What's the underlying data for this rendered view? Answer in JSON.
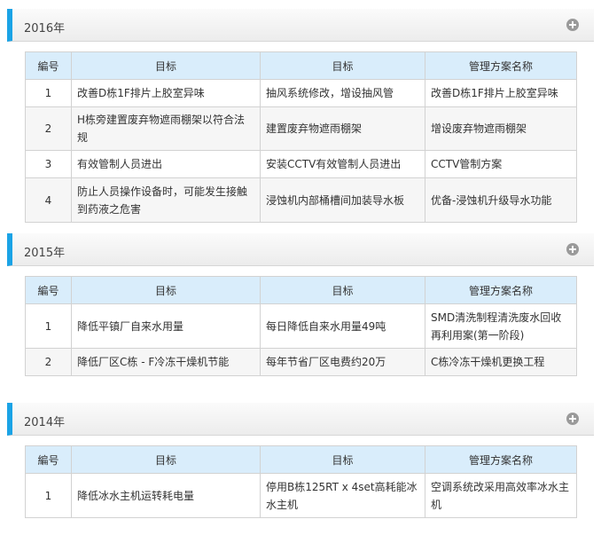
{
  "sections": [
    {
      "year": "2016年",
      "headers": [
        "編号",
        "目标",
        "目标",
        "管理方案名称"
      ],
      "rows": [
        [
          "1",
          "改善D栋1F排片上胶室异味",
          "抽风系统修改，增设抽风管",
          "改善D栋1F排片上胶室异味"
        ],
        [
          "2",
          "H栋旁建置废弃物遮雨棚架以符合法规",
          "建置废弃物遮雨棚架",
          "增设废弃物遮雨棚架"
        ],
        [
          "3",
          "有效管制人员进出",
          "安装CCTV有效管制人员进出",
          "CCTV管制方案"
        ],
        [
          "4",
          "防止人员操作设备时，可能发生接触到药液之危害",
          "浸蚀机内部桶槽间加装导水板",
          "优备-浸蚀机升级导水功能"
        ]
      ]
    },
    {
      "year": "2015年",
      "headers": [
        "編号",
        "目标",
        "目标",
        "管理方案名称"
      ],
      "rows": [
        [
          "1",
          "降低平镇厂自来水用量",
          "每日降低自来水用量49吨",
          "SMD清洗制程清洗废水回收再利用案(第一阶段)"
        ],
        [
          "2",
          "降低厂区C栋 - F冷冻干燥机节能",
          "每年节省厂区电费约20万",
          "C栋冷冻干燥机更换工程"
        ]
      ]
    },
    {
      "year": "2014年",
      "headers": [
        "編号",
        "目标",
        "目标",
        "管理方案名称"
      ],
      "rows": [
        [
          "1",
          "降低冰水主机运转耗电量",
          "停用B栋125RT x 4set高耗能冰水主机",
          "空调系统改采用高效率冰水主机"
        ]
      ]
    }
  ],
  "icons": {
    "expand": "plus-circle-icon"
  },
  "colors": {
    "accent": "#1aa3e6",
    "table_header": "#d9edfb",
    "row_alt": "#f6f6f6"
  }
}
